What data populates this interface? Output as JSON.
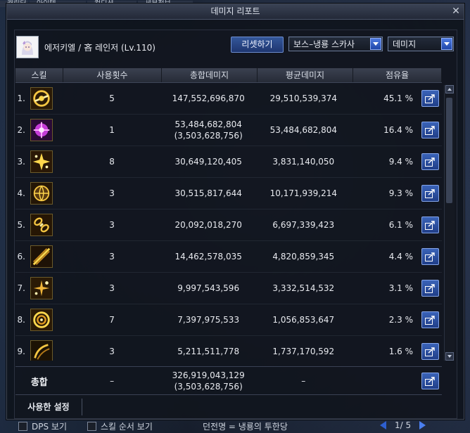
{
  "background": {
    "tabs": [
      "캐릭터",
      "아이템",
      "컨디션",
      "세부정보"
    ]
  },
  "window": {
    "title": "데미지 리포트"
  },
  "character": {
    "name": "에저키엘",
    "title": "吝 레인저 (Lv.110)"
  },
  "controls": {
    "reset_label": "리셋하기",
    "boss_select": "보스–냉룡 스카사",
    "type_select": "데미지"
  },
  "table": {
    "headers": {
      "skill": "스킬",
      "count": "사용횟수",
      "total": "총합데미지",
      "avg": "평균데미지",
      "share": "점유율"
    },
    "rows": [
      {
        "idx": "1.",
        "count": "5",
        "total": "147,552,696,870",
        "total_sub": "",
        "avg": "29,510,539,374",
        "share": "45.1 %"
      },
      {
        "idx": "2.",
        "count": "1",
        "total": "53,484,682,804",
        "total_sub": "(3,503,628,756)",
        "avg": "53,484,682,804",
        "share": "16.4 %"
      },
      {
        "idx": "3.",
        "count": "8",
        "total": "30,649,120,405",
        "total_sub": "",
        "avg": "3,831,140,050",
        "share": "9.4 %"
      },
      {
        "idx": "4.",
        "count": "3",
        "total": "30,515,817,644",
        "total_sub": "",
        "avg": "10,171,939,214",
        "share": "9.3 %"
      },
      {
        "idx": "5.",
        "count": "3",
        "total": "20,092,018,270",
        "total_sub": "",
        "avg": "6,697,339,423",
        "share": "6.1 %"
      },
      {
        "idx": "6.",
        "count": "3",
        "total": "14,462,578,035",
        "total_sub": "",
        "avg": "4,820,859,345",
        "share": "4.4 %"
      },
      {
        "idx": "7.",
        "count": "3",
        "total": "9,997,543,596",
        "total_sub": "",
        "avg": "3,332,514,532",
        "share": "3.1 %"
      },
      {
        "idx": "8.",
        "count": "7",
        "total": "7,397,975,533",
        "total_sub": "",
        "avg": "1,056,853,647",
        "share": "2.3 %"
      },
      {
        "idx": "9.",
        "count": "3",
        "total": "5,211,511,778",
        "total_sub": "",
        "avg": "1,737,170,592",
        "share": "1.6 %"
      }
    ],
    "total": {
      "label": "총합",
      "count": "–",
      "total": "326,919,043,129",
      "total_sub": "(3,503,628,756)",
      "avg": "–"
    }
  },
  "settings_tab": "사용한 설정",
  "bottom": {
    "dps_label": "DPS 보기",
    "skill_order_label": "스킬 순서 보기",
    "dungeon": "던전명 = 냉룡의 투한당",
    "page": "1/ 5"
  },
  "colors": {
    "accent": "#2e5fd0",
    "window_bg": "#0e121a",
    "text": "#e6e6e6"
  }
}
